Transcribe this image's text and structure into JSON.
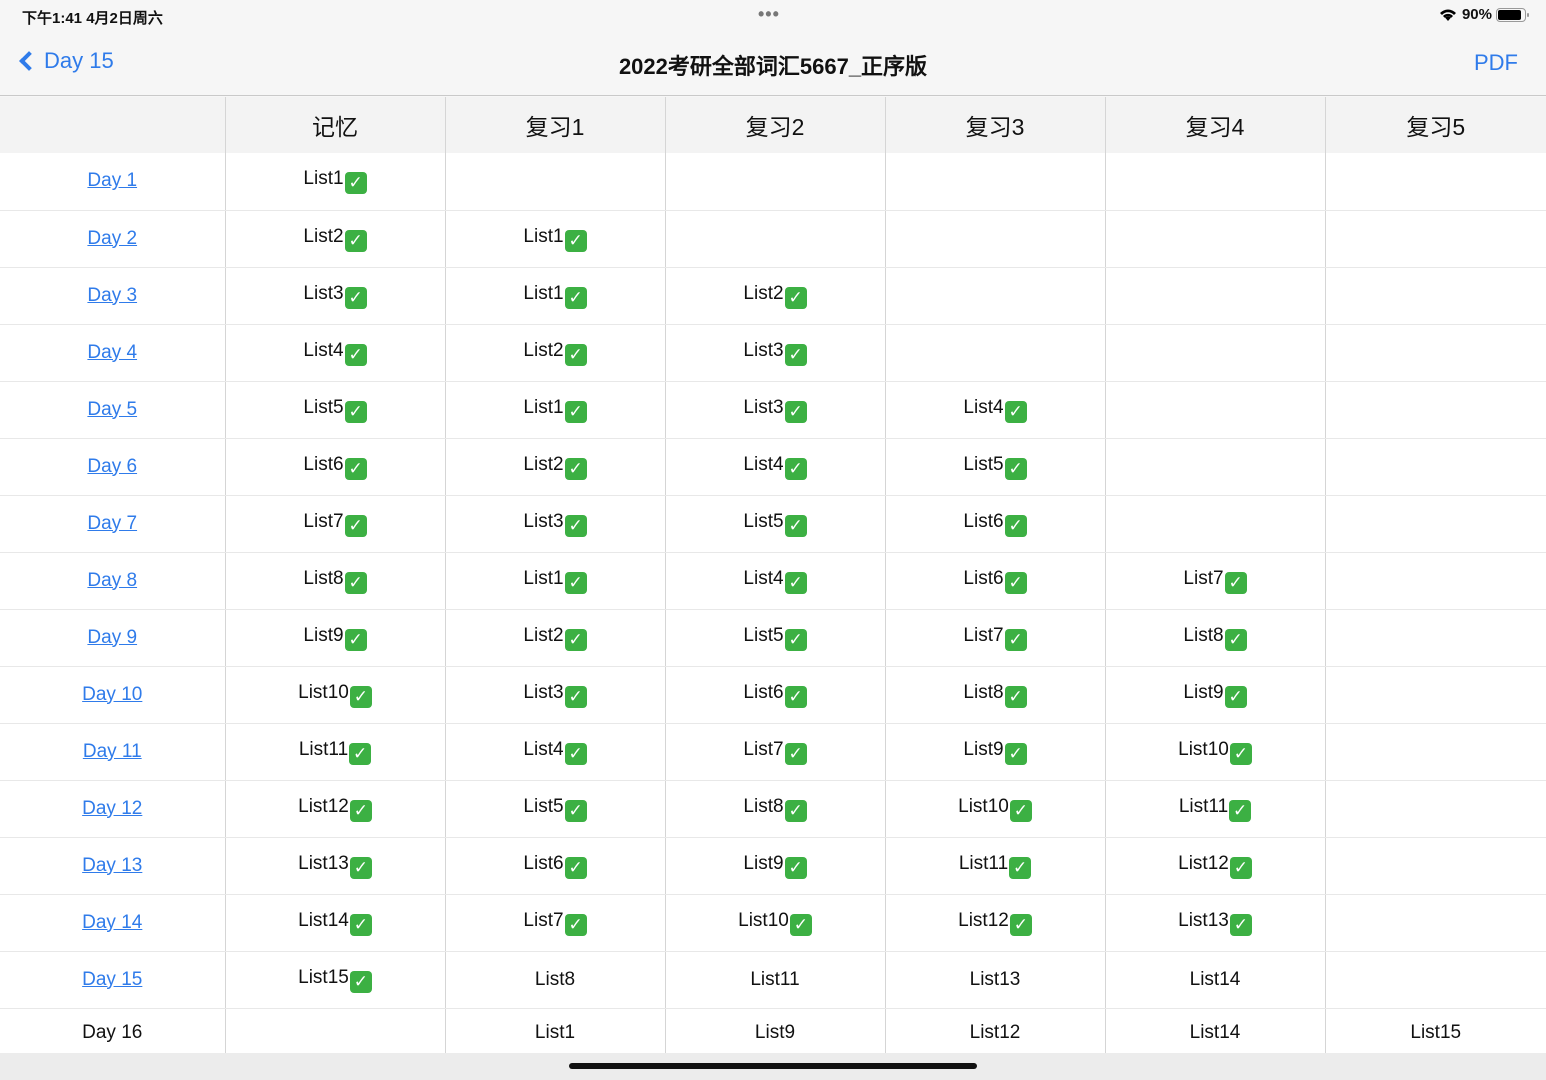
{
  "status": {
    "time": "下午1:41   4月2日周六",
    "battery": "90%",
    "battery_level": 0.9
  },
  "nav": {
    "back": "Day 15",
    "title": "2022考研全部词汇5667_正序版",
    "pdf": "PDF"
  },
  "columns": [
    "",
    "记忆",
    "复习1",
    "复习2",
    "复习3",
    "复习4",
    "复习5"
  ],
  "rows": [
    {
      "day": "Day 1",
      "link": true,
      "cells": [
        [
          "List1",
          true
        ],
        [
          "",
          false
        ],
        [
          "",
          false
        ],
        [
          "",
          false
        ],
        [
          "",
          false
        ],
        [
          "",
          false
        ]
      ]
    },
    {
      "day": "Day 2",
      "link": true,
      "cells": [
        [
          "List2",
          true
        ],
        [
          "List1",
          true
        ],
        [
          "",
          false
        ],
        [
          "",
          false
        ],
        [
          "",
          false
        ],
        [
          "",
          false
        ]
      ]
    },
    {
      "day": "Day 3",
      "link": true,
      "cells": [
        [
          "List3",
          true
        ],
        [
          "List1",
          true
        ],
        [
          "List2",
          true
        ],
        [
          "",
          false
        ],
        [
          "",
          false
        ],
        [
          "",
          false
        ]
      ]
    },
    {
      "day": "Day 4",
      "link": true,
      "cells": [
        [
          "List4",
          true
        ],
        [
          "List2",
          true
        ],
        [
          "List3",
          true
        ],
        [
          "",
          false
        ],
        [
          "",
          false
        ],
        [
          "",
          false
        ]
      ]
    },
    {
      "day": "Day 5",
      "link": true,
      "cells": [
        [
          "List5",
          true
        ],
        [
          "List1",
          true
        ],
        [
          "List3",
          true
        ],
        [
          "List4",
          true
        ],
        [
          "",
          false
        ],
        [
          "",
          false
        ]
      ]
    },
    {
      "day": "Day 6",
      "link": true,
      "cells": [
        [
          "List6",
          true
        ],
        [
          "List2",
          true
        ],
        [
          "List4",
          true
        ],
        [
          "List5",
          true
        ],
        [
          "",
          false
        ],
        [
          "",
          false
        ]
      ]
    },
    {
      "day": "Day 7",
      "link": true,
      "cells": [
        [
          "List7",
          true
        ],
        [
          "List3",
          true
        ],
        [
          "List5",
          true
        ],
        [
          "List6",
          true
        ],
        [
          "",
          false
        ],
        [
          "",
          false
        ]
      ]
    },
    {
      "day": "Day 8",
      "link": true,
      "cells": [
        [
          "List8",
          true
        ],
        [
          "List1",
          true
        ],
        [
          "List4",
          true
        ],
        [
          "List6",
          true
        ],
        [
          "List7",
          true
        ],
        [
          "",
          false
        ]
      ]
    },
    {
      "day": "Day 9",
      "link": true,
      "cells": [
        [
          "List9",
          true
        ],
        [
          "List2",
          true
        ],
        [
          "List5",
          true
        ],
        [
          "List7",
          true
        ],
        [
          "List8",
          true
        ],
        [
          "",
          false
        ]
      ]
    },
    {
      "day": "Day 10",
      "link": true,
      "cells": [
        [
          "List10",
          true
        ],
        [
          "List3",
          true
        ],
        [
          "List6",
          true
        ],
        [
          "List8",
          true
        ],
        [
          "List9",
          true
        ],
        [
          "",
          false
        ]
      ]
    },
    {
      "day": "Day 11",
      "link": true,
      "cells": [
        [
          "List11",
          true
        ],
        [
          "List4",
          true
        ],
        [
          "List7",
          true
        ],
        [
          "List9",
          true
        ],
        [
          "List10",
          true
        ],
        [
          "",
          false
        ]
      ]
    },
    {
      "day": "Day 12",
      "link": true,
      "cells": [
        [
          "List12",
          true
        ],
        [
          "List5",
          true
        ],
        [
          "List8",
          true
        ],
        [
          "List10",
          true
        ],
        [
          "List11",
          true
        ],
        [
          "",
          false
        ]
      ]
    },
    {
      "day": "Day 13",
      "link": true,
      "cells": [
        [
          "List13",
          true
        ],
        [
          "List6",
          true
        ],
        [
          "List9",
          true
        ],
        [
          "List11",
          true
        ],
        [
          "List12",
          true
        ],
        [
          "",
          false
        ]
      ]
    },
    {
      "day": "Day 14",
      "link": true,
      "cells": [
        [
          "List14",
          true
        ],
        [
          "List7",
          true
        ],
        [
          "List10",
          true
        ],
        [
          "List12",
          true
        ],
        [
          "List13",
          true
        ],
        [
          "",
          false
        ]
      ]
    },
    {
      "day": "Day 15",
      "link": true,
      "cells": [
        [
          "List15",
          true
        ],
        [
          "List8",
          false
        ],
        [
          "List11",
          false
        ],
        [
          "List13",
          false
        ],
        [
          "List14",
          false
        ],
        [
          "",
          false
        ]
      ]
    },
    {
      "day": "Day 16",
      "link": false,
      "cells": [
        [
          "",
          false
        ],
        [
          "List1",
          false
        ],
        [
          "List9",
          false
        ],
        [
          "List12",
          false
        ],
        [
          "List14",
          false
        ],
        [
          "List15",
          false
        ]
      ]
    }
  ]
}
